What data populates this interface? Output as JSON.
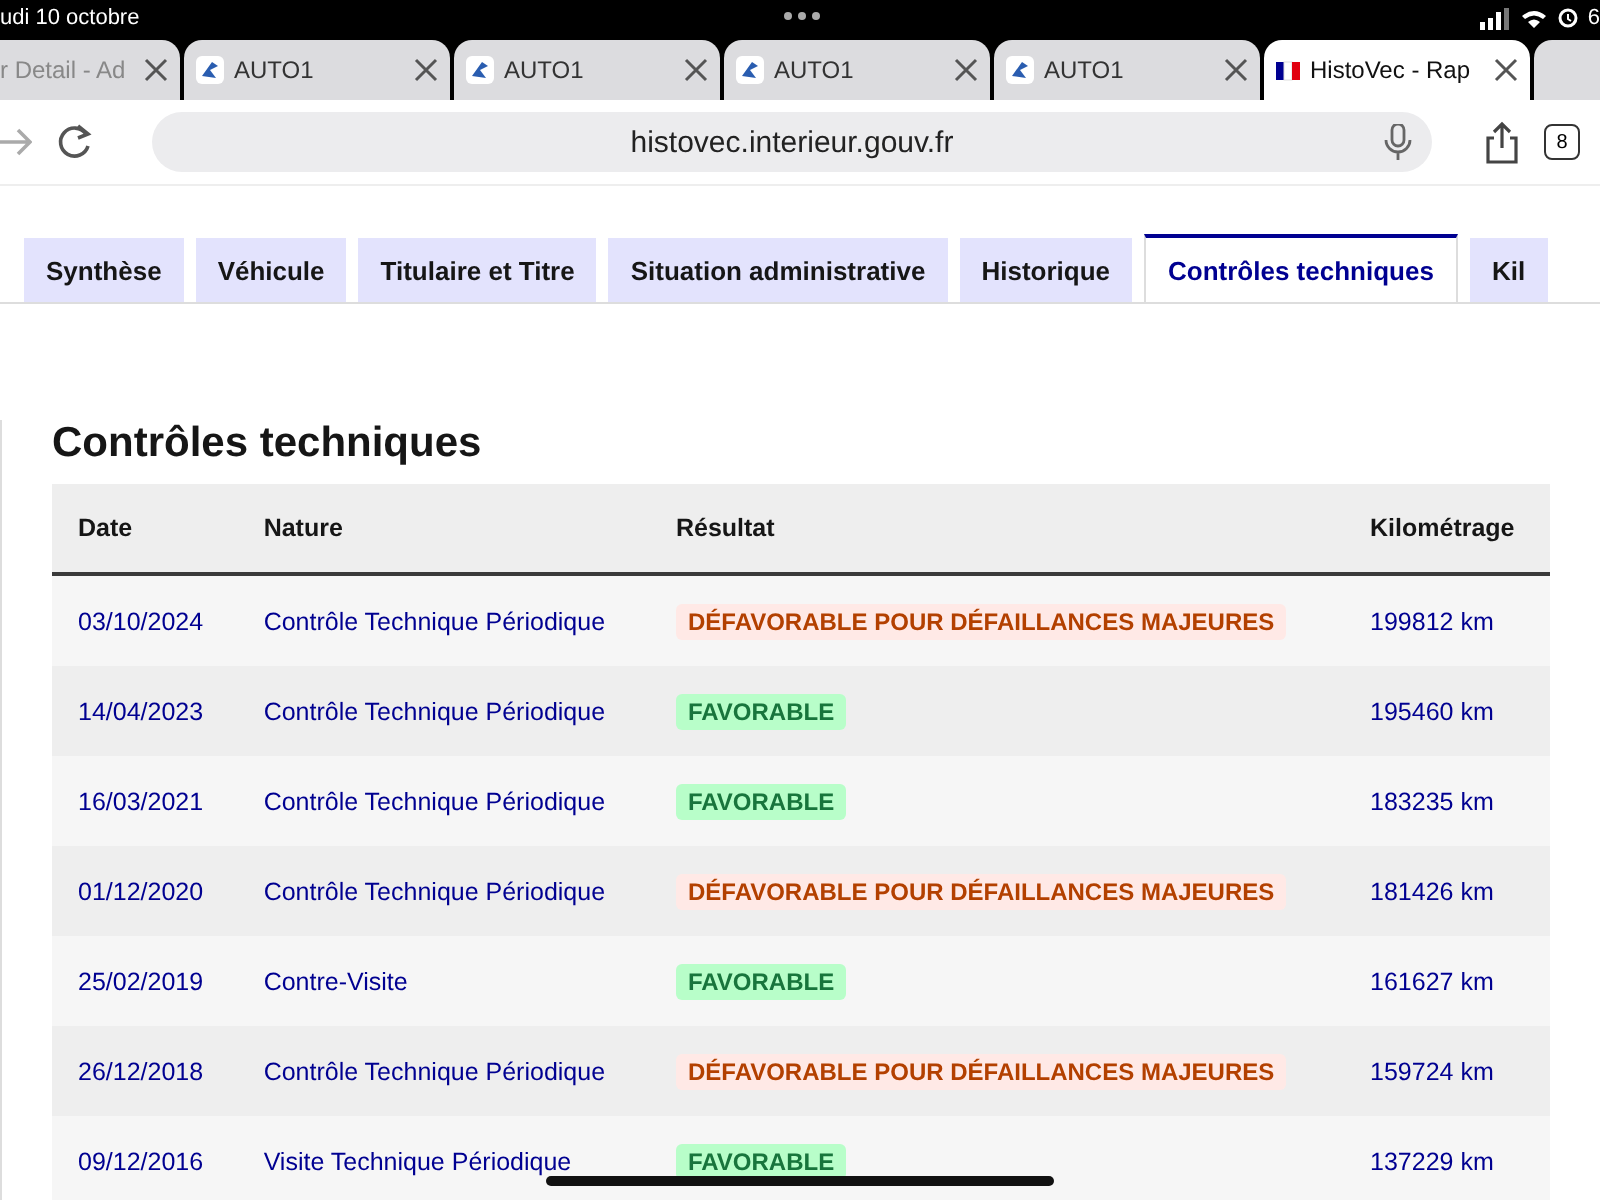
{
  "status_bar": {
    "date": "udi 10 octobre",
    "battery": "6"
  },
  "browser_tabs": [
    {
      "title": "r Detail - Ad",
      "kind": "plain",
      "selected": false
    },
    {
      "title": "AUTO1",
      "kind": "auto",
      "selected": false
    },
    {
      "title": "AUTO1",
      "kind": "auto",
      "selected": false
    },
    {
      "title": "AUTO1",
      "kind": "auto",
      "selected": false
    },
    {
      "title": "AUTO1",
      "kind": "auto",
      "selected": false
    },
    {
      "title": "HistoVec - Rap",
      "kind": "flag",
      "selected": true
    }
  ],
  "address_bar": {
    "url": "histovec.interieur.gouv.fr",
    "tab_count": "8"
  },
  "page_tabs": [
    {
      "label": "Synthèse",
      "selected": false
    },
    {
      "label": "Véhicule",
      "selected": false
    },
    {
      "label": "Titulaire et Titre",
      "selected": false
    },
    {
      "label": "Situation administrative",
      "selected": false
    },
    {
      "label": "Historique",
      "selected": false
    },
    {
      "label": "Contrôles techniques",
      "selected": true
    },
    {
      "label": "Kil",
      "selected": false
    }
  ],
  "heading": "Contrôles techniques",
  "table": {
    "columns": [
      "Date",
      "Nature",
      "Résultat",
      "Kilométrage"
    ],
    "rows": [
      {
        "date": "03/10/2024",
        "nature": "Contrôle Technique Périodique",
        "result": "DÉFAVORABLE POUR DÉFAILLANCES MAJEURES",
        "kind": "unfavorable",
        "mileage": "199812 km"
      },
      {
        "date": "14/04/2023",
        "nature": "Contrôle Technique Périodique",
        "result": "FAVORABLE",
        "kind": "favorable",
        "mileage": "195460 km"
      },
      {
        "date": "16/03/2021",
        "nature": "Contrôle Technique Périodique",
        "result": "FAVORABLE",
        "kind": "favorable",
        "mileage": "183235 km"
      },
      {
        "date": "01/12/2020",
        "nature": "Contrôle Technique Périodique",
        "result": "DÉFAVORABLE POUR DÉFAILLANCES MAJEURES",
        "kind": "unfavorable",
        "mileage": "181426 km"
      },
      {
        "date": "25/02/2019",
        "nature": "Contre-Visite",
        "result": "FAVORABLE",
        "kind": "favorable",
        "mileage": "161627 km"
      },
      {
        "date": "26/12/2018",
        "nature": "Contrôle Technique Périodique",
        "result": "DÉFAVORABLE POUR DÉFAILLANCES MAJEURES",
        "kind": "unfavorable",
        "mileage": "159724 km"
      },
      {
        "date": "09/12/2016",
        "nature": "Visite Technique Périodique",
        "result": "FAVORABLE",
        "kind": "favorable",
        "mileage": "137229 km"
      }
    ]
  }
}
